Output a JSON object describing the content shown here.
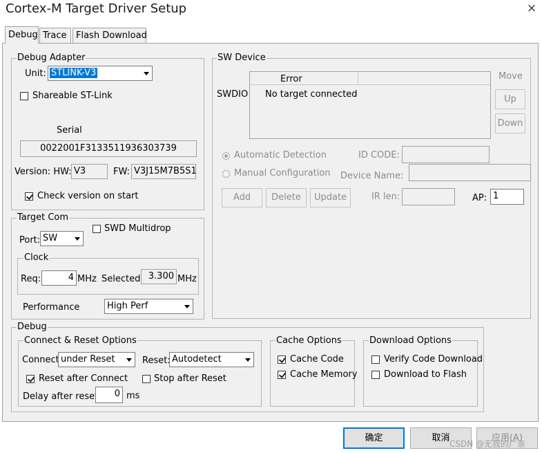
{
  "window": {
    "title": "Cortex-M Target Driver Setup",
    "close_glyph": "×"
  },
  "tabs": [
    {
      "label": "Debug",
      "active": true
    },
    {
      "label": "Trace",
      "active": false
    },
    {
      "label": "Flash Download",
      "active": false
    }
  ],
  "debug_adapter": {
    "title": "Debug Adapter",
    "unit_label": "Unit:",
    "unit_value": "STLINK-V3",
    "shareable_label": "Shareable ST-Link",
    "shareable_checked": false,
    "serial_label": "Serial",
    "serial_value": "0022001F3133511936303739",
    "version_label": "Version: HW:",
    "hw_value": "V3",
    "fw_label": "FW:",
    "fw_value": "V3J15M7B5S1",
    "check_version_label": "Check version on start",
    "check_version_checked": true
  },
  "target_com": {
    "title": "Target Com",
    "swd_multidrop_label": "SWD Multidrop",
    "swd_multidrop_checked": false,
    "port_label": "Port:",
    "port_value": "SW",
    "clock_title": "Clock",
    "req_label": "Req:",
    "req_value": "4",
    "req_unit": "MHz",
    "selected_label": "Selected:",
    "selected_value": "3.300",
    "selected_unit": "MHz",
    "performance_label": "Performance",
    "performance_value": "High Perf"
  },
  "sw_device": {
    "title": "SW Device",
    "swdio_label": "SWDIO",
    "table_header": "Error",
    "table_row": "No target connected",
    "move_label": "Move",
    "up_label": "Up",
    "down_label": "Down",
    "auto_detect_label": "Automatic Detection",
    "auto_detect_selected": true,
    "manual_config_label": "Manual Configuration",
    "id_code_label": "ID CODE:",
    "device_name_label": "Device Name:",
    "add_label": "Add",
    "delete_label": "Delete",
    "update_label": "Update",
    "ir_len_label": "IR len:",
    "ap_label": "AP:",
    "ap_value": "1"
  },
  "debug": {
    "title": "Debug",
    "connect_reset": {
      "title": "Connect & Reset Options",
      "connect_label": "Connect:",
      "connect_value": "under Reset",
      "reset_label": "Reset:",
      "reset_value": "Autodetect",
      "reset_after_connect_label": "Reset after Connect",
      "reset_after_connect_checked": true,
      "stop_after_reset_label": "Stop after Reset",
      "stop_after_reset_checked": false,
      "delay_label": "Delay after reset:",
      "delay_value": "0",
      "delay_unit": "ms"
    },
    "cache": {
      "title": "Cache Options",
      "cache_code_label": "Cache Code",
      "cache_code_checked": true,
      "cache_memory_label": "Cache Memory",
      "cache_memory_checked": true
    },
    "download": {
      "title": "Download Options",
      "verify_label": "Verify Code Download",
      "verify_checked": false,
      "download_flash_label": "Download to Flash",
      "download_flash_checked": false
    }
  },
  "buttons": {
    "ok": "确定",
    "cancel": "取消",
    "apply": "应用(A)"
  },
  "watermark": "CSDN @无我的广亲",
  "colors": {
    "selection": "#0078d7",
    "dialog_bg": "#f0f0f0",
    "default_button_border": "#0078d7"
  }
}
